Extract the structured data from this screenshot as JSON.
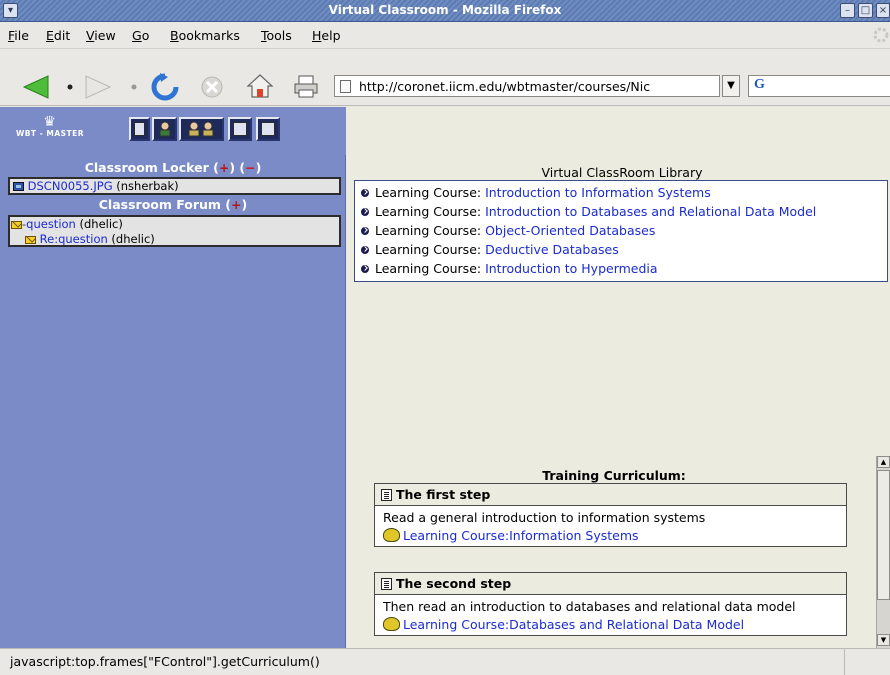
{
  "window": {
    "title": "Virtual Classroom - Mozilla Firefox"
  },
  "menu": [
    {
      "label": "File",
      "accel": "F",
      "rest": "ile"
    },
    {
      "label": "Edit",
      "accel": "E",
      "rest": "dit"
    },
    {
      "label": "View",
      "accel": "V",
      "rest": "iew"
    },
    {
      "label": "Go",
      "accel": "G",
      "rest": "o"
    },
    {
      "label": "Bookmarks",
      "accel": "B",
      "rest": "ookmarks"
    },
    {
      "label": "Tools",
      "accel": "T",
      "rest": "ools"
    },
    {
      "label": "Help",
      "accel": "H",
      "rest": "elp"
    }
  ],
  "toolbar": {
    "url": "http://coronet.iicm.edu/wbtmaster/courses/Nic",
    "search_logo": "G"
  },
  "wbt": {
    "logo_text": "WBT - MASTER"
  },
  "locker": {
    "heading": "Classroom Locker",
    "add": "+",
    "remove": "−",
    "items": [
      {
        "link": "DSCN0055.JPG",
        "owner": "(nsherbak)"
      }
    ]
  },
  "forum": {
    "heading": "Classroom Forum",
    "add": "+",
    "items": [
      {
        "link": "question",
        "owner": "(dhelic)"
      },
      {
        "link": "Re:question",
        "owner": "(dhelic)"
      }
    ]
  },
  "library": {
    "heading": "Virtual ClassRoom Library",
    "prefix": "Learning Course:",
    "courses": [
      "Introduction to Information Systems",
      "Introduction to Databases and Relational Data Model",
      "Object-Oriented Databases",
      "Deductive Databases",
      "Introduction to Hypermedia"
    ]
  },
  "curriculum": {
    "heading": "Training Curriculum:",
    "steps": [
      {
        "title": "The first step",
        "description": "Read a general introduction to information systems",
        "link": "Learning Course:Information Systems"
      },
      {
        "title": "The second step",
        "description": "Then read an introduction to databases and relational data model",
        "link": "Learning Course:Databases and Relational Data Model"
      }
    ]
  },
  "status": {
    "text": "javascript:top.frames[\"FControl\"].getCurriculum()"
  },
  "colors": {
    "left_frame": "#7b8bc8",
    "link": "#1a2bd1",
    "content_bg": "#ecebe0"
  }
}
